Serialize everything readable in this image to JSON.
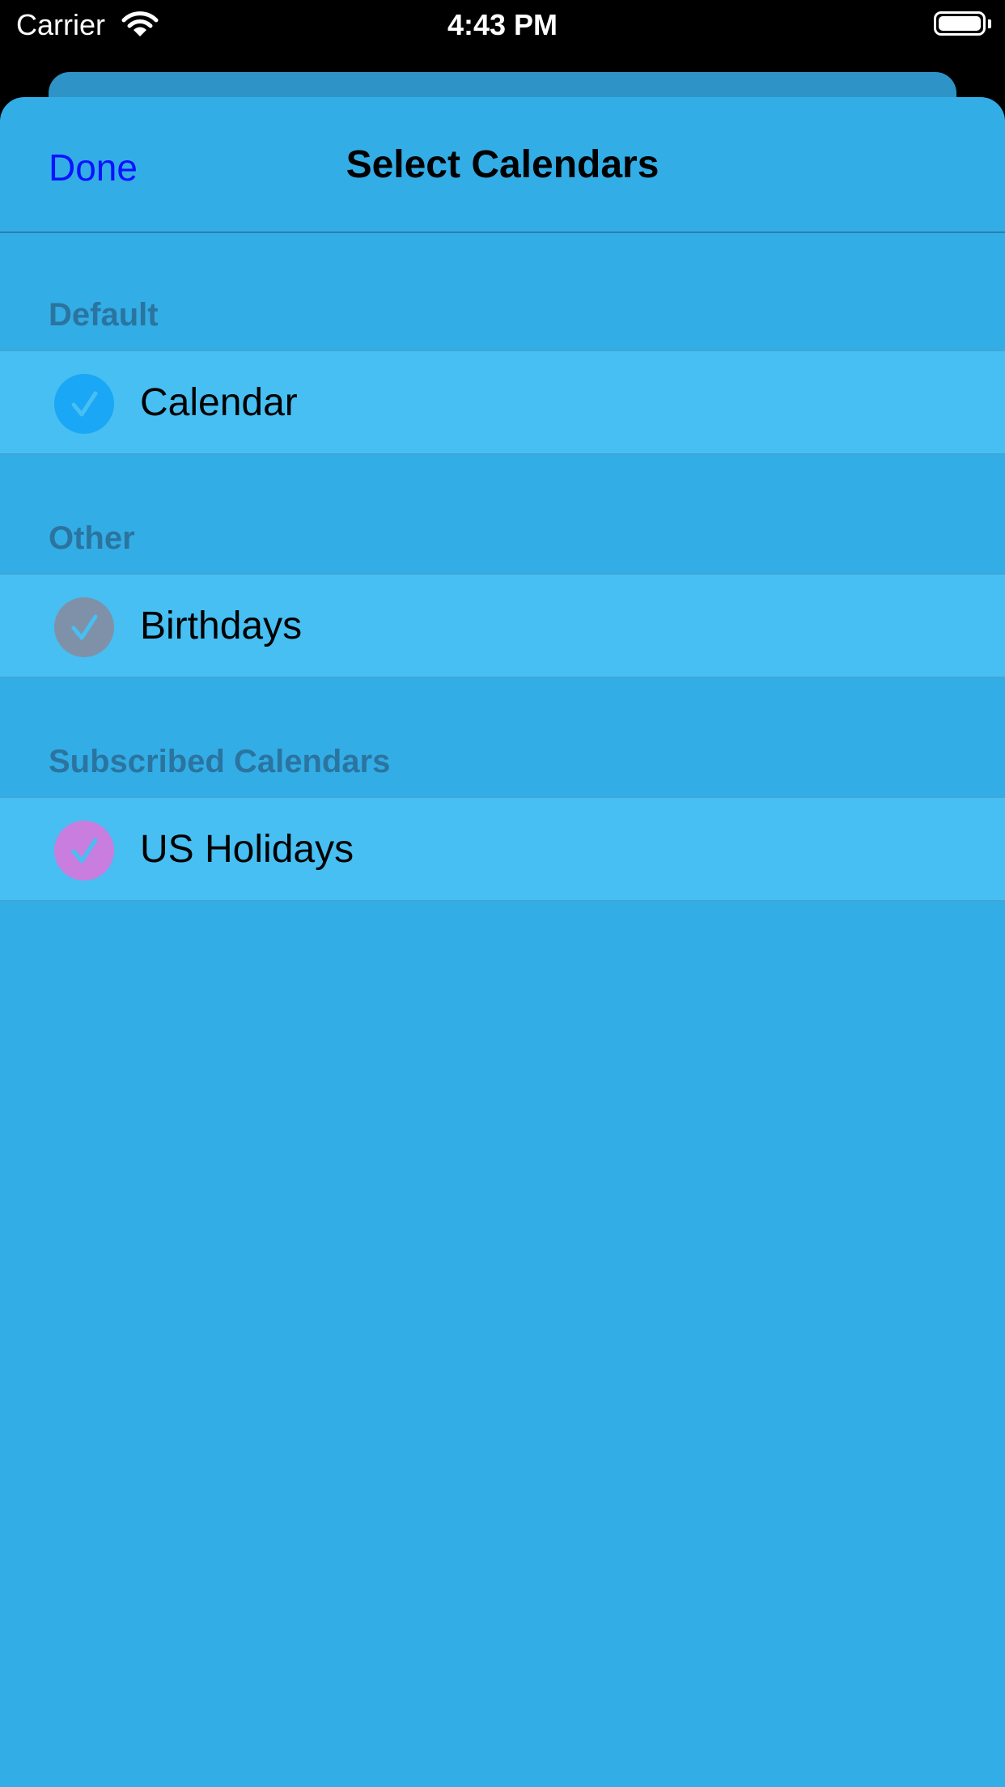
{
  "status_bar": {
    "carrier": "Carrier",
    "time": "4:43 PM",
    "wifi_icon": "wifi-icon",
    "battery_icon": "battery-icon",
    "battery_level": 1.0
  },
  "nav": {
    "done_label": "Done",
    "title": "Select Calendars"
  },
  "sections": [
    {
      "header": "Default",
      "items": [
        {
          "label": "Calendar",
          "selected": true,
          "color": "#1aa7f5"
        }
      ]
    },
    {
      "header": "Other",
      "items": [
        {
          "label": "Birthdays",
          "selected": true,
          "color": "#7f91a9"
        }
      ]
    },
    {
      "header": "Subscribed Calendars",
      "items": [
        {
          "label": "US Holidays",
          "selected": true,
          "color": "#c97ddf"
        }
      ]
    }
  ],
  "colors": {
    "sheet_background": "#33ade6",
    "row_background": "#47bff2",
    "done_link": "#0a12ff",
    "section_header_text": "#2b749f",
    "checkmark": "#47bff2"
  }
}
